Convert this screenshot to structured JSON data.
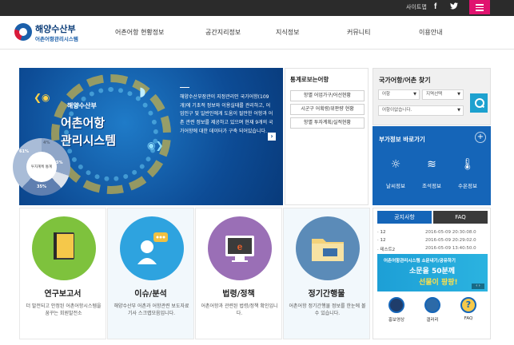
{
  "topbar": {
    "sitemap": "사이트맵",
    "facebook_icon": "facebook-icon",
    "twitter_icon": "twitter-icon",
    "menu_color": "#e0136f"
  },
  "logo": {
    "title": "해양수산부",
    "subtitle": "어촌어항관리시스템"
  },
  "nav": [
    "어촌어항 현황정보",
    "공간지리정보",
    "지식정보",
    "커뮤니티",
    "이용안내"
  ],
  "hero": {
    "badge": "해양수산부",
    "line1": "어촌어항",
    "line2": "관리시스템",
    "description": "해양수산부장관이 지정관리인 국가어항(109개)에 기초적 정보와 이용실태를 관리하고, 어업인구 및 일반인에게 도움이 될만한 어항과 어촌 관련 정보를 제공하고 있으며 현재 9개의 국가어항에 대한 데이터가 구축 되어있습니다."
  },
  "stats": {
    "title": "통계로보는어항",
    "buttons": [
      "항별 어업가구/어선현황",
      "시군구 어획량/위판량 현황",
      "항별 투자계획/실적현황"
    ],
    "donut_label": "투자계획 통계",
    "segments": [
      "61%",
      "4%",
      "5%",
      "35%"
    ]
  },
  "search": {
    "title": "국가어항/어촌 찾기",
    "select1": "어항",
    "select2": "지역선택",
    "select3": "어항이없습니다."
  },
  "extra": {
    "title": "부가정보 바로가기",
    "items": [
      {
        "label": "날씨정보",
        "icon": "weather-icon"
      },
      {
        "label": "조석정보",
        "icon": "tide-icon"
      },
      {
        "label": "수온정보",
        "icon": "thermometer-icon"
      }
    ]
  },
  "cards": [
    {
      "title": "연구보고서",
      "desc": "더 발전되고 안정된 어촌어항시스템을 꿈꾸는 회원발전소",
      "color": "#7ec23d",
      "icon": "book-icon"
    },
    {
      "title": "이슈/분석",
      "desc": "해양수산부 어촌과 어항관련 보도자료 기사 스크랩모음입니다.",
      "color": "#2ea3df",
      "icon": "presenter-icon"
    },
    {
      "title": "법령/정책",
      "desc": "어촌어항과 관련된 법령/정책 확인입니다.",
      "color": "#9a6fb6",
      "icon": "monitor-icon"
    },
    {
      "title": "정기간행물",
      "desc": "어촌어항 정기간행물 정보를 한눈에 볼 수 있습니다.",
      "color": "#5b8bb8",
      "icon": "folder-icon"
    }
  ],
  "notice": {
    "tabs": [
      "공지사항",
      "FAQ"
    ],
    "rows": [
      {
        "title": "· 12",
        "date": "2016-05-09 20:30:08.0"
      },
      {
        "title": "· 12",
        "date": "2016-05-09 20:29:02.0"
      },
      {
        "title": "· 테스트2",
        "date": "2016-05-09 13:40:50.0"
      }
    ],
    "banner": {
      "small": "어촌어항관리시스템 소문내기/공유하기",
      "big1": "소문을 50분께",
      "big2": "선물이 팡팡!",
      "pager": "‹ ›"
    },
    "quick": [
      {
        "label": "홍보영상",
        "icon": "video-icon"
      },
      {
        "label": "갤러리",
        "icon": "gallery-icon"
      },
      {
        "label": "FAQ",
        "icon": "question-icon"
      }
    ]
  }
}
